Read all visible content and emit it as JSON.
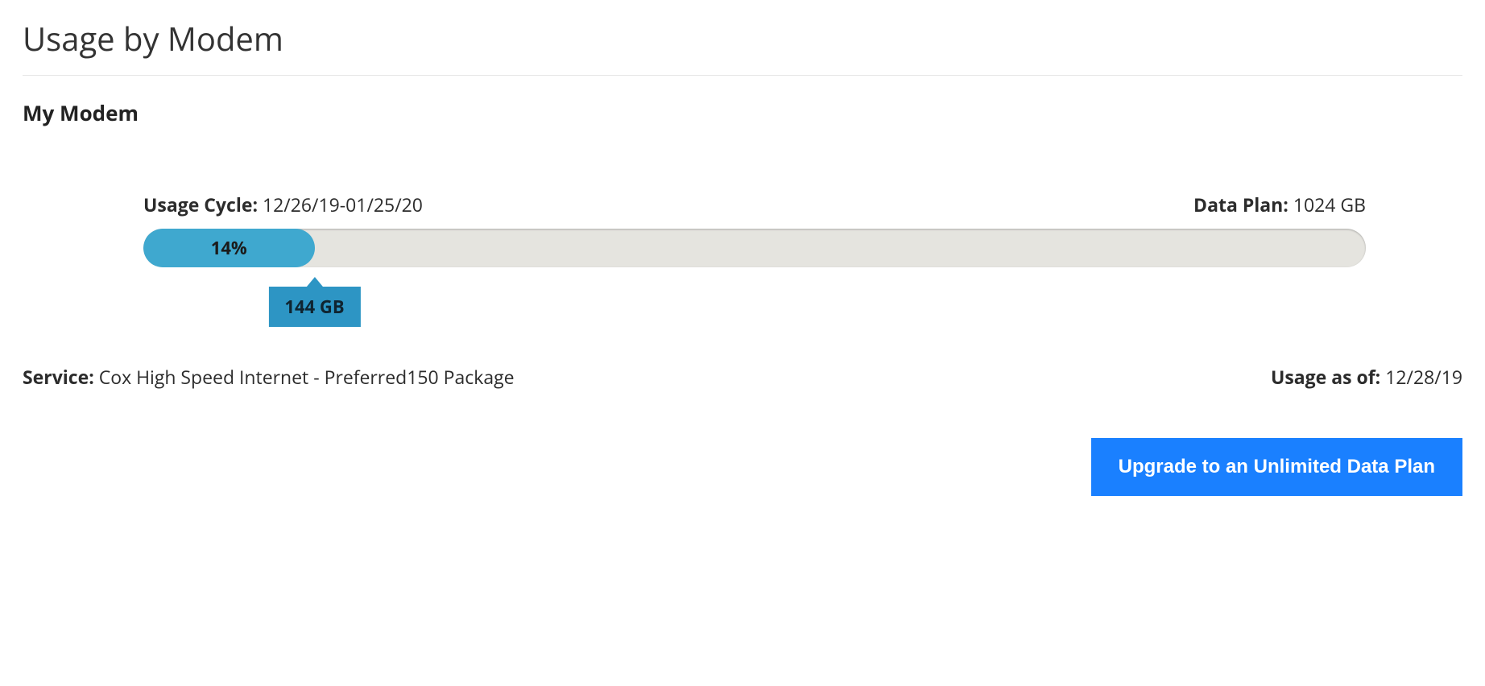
{
  "header": {
    "title": "Usage by Modem",
    "modem_name": "My Modem"
  },
  "usage": {
    "cycle_label": "Usage Cycle:",
    "cycle_value": "12/26/19-01/25/20",
    "plan_label": "Data Plan:",
    "plan_value": "1024 GB",
    "percent_used": 14,
    "percent_label": "14%",
    "used_label": "144 GB"
  },
  "service": {
    "label": "Service:",
    "value": "Cox High Speed Internet - Preferred150 Package"
  },
  "asof": {
    "label": "Usage as of:",
    "value": "12/28/19"
  },
  "actions": {
    "upgrade_label": "Upgrade to an Unlimited Data Plan"
  },
  "chart_data": {
    "type": "bar",
    "orientation": "horizontal",
    "categories": [
      "Usage"
    ],
    "values": [
      144
    ],
    "max": 1024,
    "unit": "GB",
    "percent": 14,
    "title": "Usage by Modem"
  }
}
